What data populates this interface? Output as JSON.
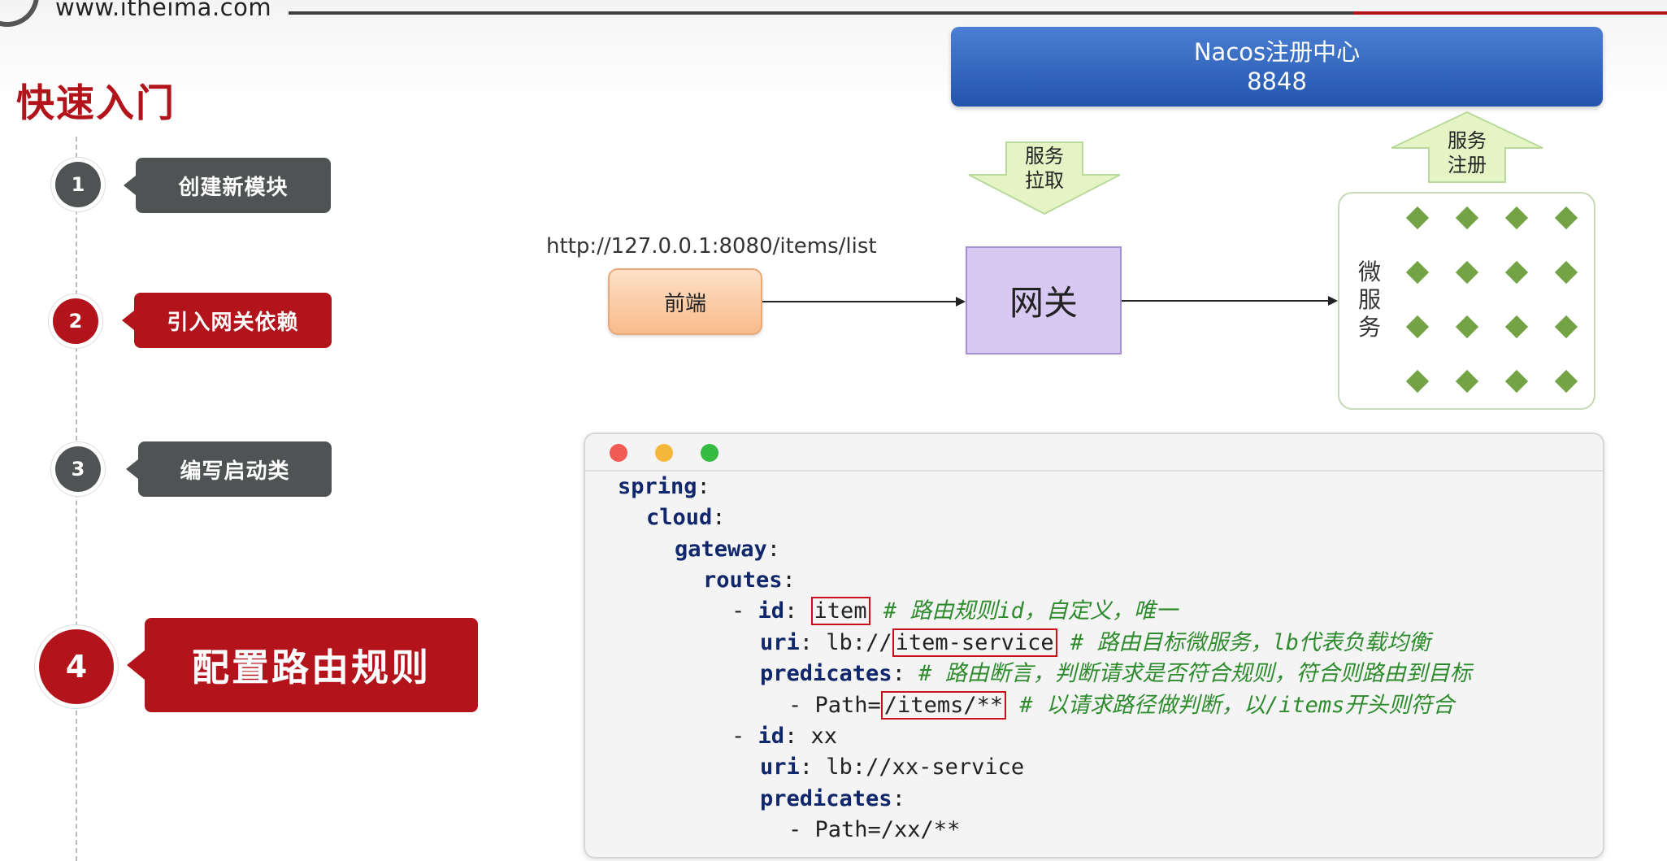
{
  "header": {
    "url": "www.itheima.com",
    "title": "快速入门"
  },
  "steps": [
    {
      "number": "1",
      "label": "创建新模块"
    },
    {
      "number": "2",
      "label": "引入网关依赖"
    },
    {
      "number": "3",
      "label": "编写启动类"
    },
    {
      "number": "4",
      "label": "配置路由规则"
    }
  ],
  "diagram": {
    "nacos_title": "Nacos注册中心",
    "nacos_port": "8848",
    "pull_line1": "服务",
    "pull_line2": "拉取",
    "register_line1": "服务",
    "register_line2": "注册",
    "request_url": "http://127.0.0.1:8080/items/list",
    "frontend": "前端",
    "gateway": "网关",
    "microservices": [
      "微",
      "服",
      "务"
    ]
  },
  "colors": {
    "brand_red": "#b3141b",
    "step_gray": "#4f5354",
    "nacos_blue": "#2f63b8",
    "arrow_green": "#e4f4c4",
    "diamond_green": "#73a344",
    "keyword_navy": "#11276b",
    "comment_green": "#2e8c2e"
  },
  "code": {
    "l1_key": "spring",
    "l2_key": "cloud",
    "l3_key": "gateway",
    "l4_key": "routes",
    "r1_id_prefix": "- ",
    "r1_id_key": "id",
    "r1_id_value": "item",
    "r1_id_comment": "# 路由规则id，自定义，唯一",
    "r1_uri_key": "uri",
    "r1_uri_prefix": "lb://",
    "r1_uri_value": "item-service",
    "r1_uri_comment": "# 路由目标微服务，lb代表负载均衡",
    "r1_pred_key": "predicates",
    "r1_pred_comment": "# 路由断言，判断请求是否符合规则，符合则路由到目标",
    "r1_path_prefix": "- Path=",
    "r1_path_value": "/items/**",
    "r1_path_comment": "# 以请求路径做判断，以/items开头则符合",
    "r2_id_key": "id",
    "r2_id_value": "xx",
    "r2_uri_key": "uri",
    "r2_uri_value": "lb://xx-service",
    "r2_pred_key": "predicates",
    "r2_path": "- Path=/xx/**"
  }
}
